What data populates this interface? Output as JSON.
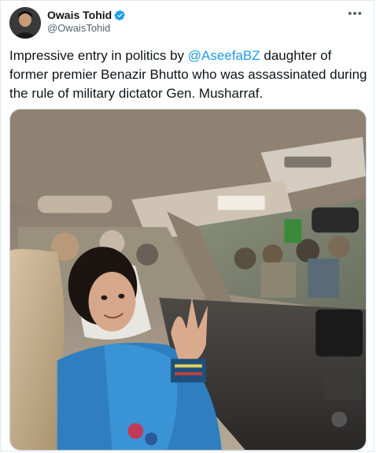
{
  "tweet": {
    "author": {
      "display_name": "Owais Tohid",
      "handle": "@OwaisTohid",
      "verified": true,
      "avatar_icon": "avatar-photo"
    },
    "more_label": "•••",
    "text_before": "Impressive entry in politics by ",
    "mention": "@AseefaBZ",
    "text_after": " daughter of former premier Benazir Bhutto who was assassinated during the rule of military dictator Gen. Musharraf.",
    "media_icon": "photo",
    "colors": {
      "link": "#1d9bf0",
      "verified": "#1d9bf0",
      "text": "#0f1419",
      "secondary": "#536471"
    }
  }
}
